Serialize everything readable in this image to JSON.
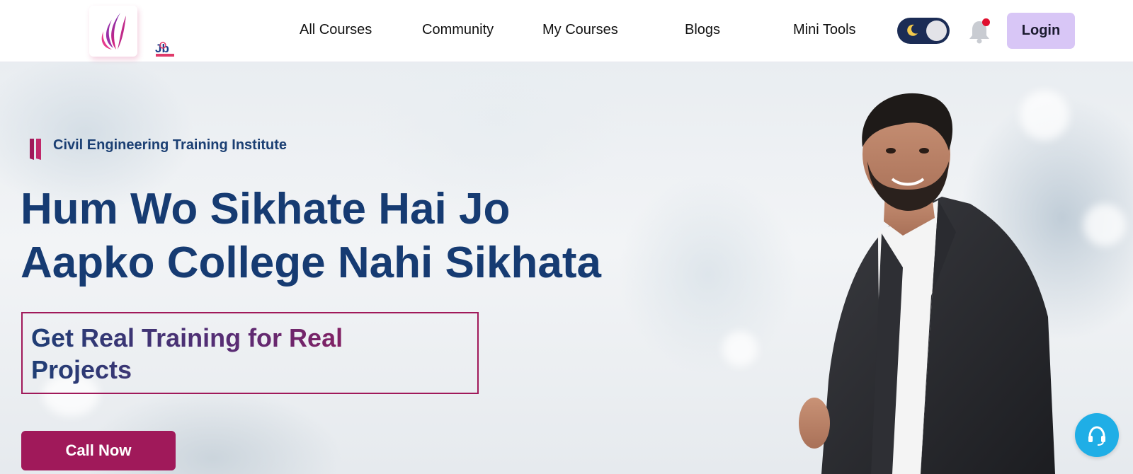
{
  "brand": {
    "logo_icon": "feather-logo-icon",
    "secondary_logo_icon": "job-builder-logo-icon"
  },
  "nav": {
    "items": [
      {
        "label": "All Courses"
      },
      {
        "label": "Community"
      },
      {
        "label": "My Courses"
      },
      {
        "label": "Blogs"
      },
      {
        "label": "Mini Tools"
      }
    ],
    "theme_toggle": {
      "icon": "moon-icon",
      "state": "dark"
    },
    "notification": {
      "icon": "bell-icon",
      "has_unread": true
    },
    "login_label": "Login"
  },
  "hero": {
    "tagline": "Civil Engineering Training Institute",
    "headline_line1": "Hum Wo Sikhate Hai Jo",
    "headline_line2": "Aapko College Nahi Sikhata",
    "subheading": "Get Real Training for Real Projects",
    "cta_label": "Call Now"
  },
  "support": {
    "icon": "headset-icon"
  },
  "colors": {
    "primary_blue": "#163b72",
    "accent_magenta": "#a0195a",
    "login_bg": "#d8c6f6",
    "toggle_bg": "#1b2c55",
    "support_bg": "#1faee6",
    "notification_dot": "#e0102f"
  }
}
